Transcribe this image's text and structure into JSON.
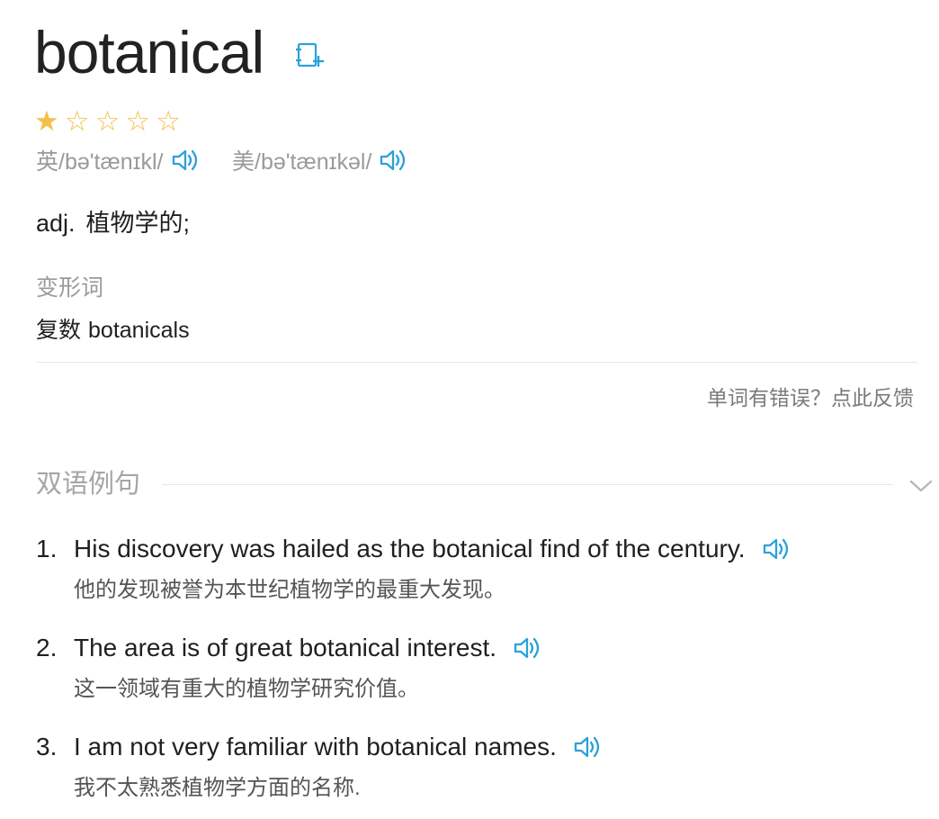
{
  "entry": {
    "word": "botanical",
    "wordbook_icon": "add-to-wordbook-icon",
    "stars": {
      "filled": 1,
      "total": 5
    }
  },
  "phonetics": {
    "uk": "英/bə'tænɪkl/",
    "us": "美/bə'tænɪkəl/",
    "speaker_icon": "speaker-icon"
  },
  "definition": {
    "pos": "adj.",
    "meaning": "植物学的;"
  },
  "inflections": {
    "label": "变形词",
    "items": [
      {
        "type": "复数",
        "value": "botanicals"
      }
    ]
  },
  "feedback": {
    "text": "单词有错误？点此反馈"
  },
  "examples": {
    "title": "双语例句",
    "chevron_icon": "chevron-down-icon",
    "items": [
      {
        "num": "1.",
        "en": "His discovery was hailed as the botanical find of the century.",
        "zh": "他的发现被誉为本世纪植物学的最重大发现。"
      },
      {
        "num": "2.",
        "en": "The area is of great botanical interest.",
        "zh": "这一领域有重大的植物学研究价值。"
      },
      {
        "num": "3.",
        "en": "I am not very familiar with botanical names.",
        "zh": "我不太熟悉植物学方面的名称."
      }
    ]
  },
  "colors": {
    "accent": "#2aa1d9",
    "star": "#f2c04d",
    "muted": "#9a9a9a"
  }
}
